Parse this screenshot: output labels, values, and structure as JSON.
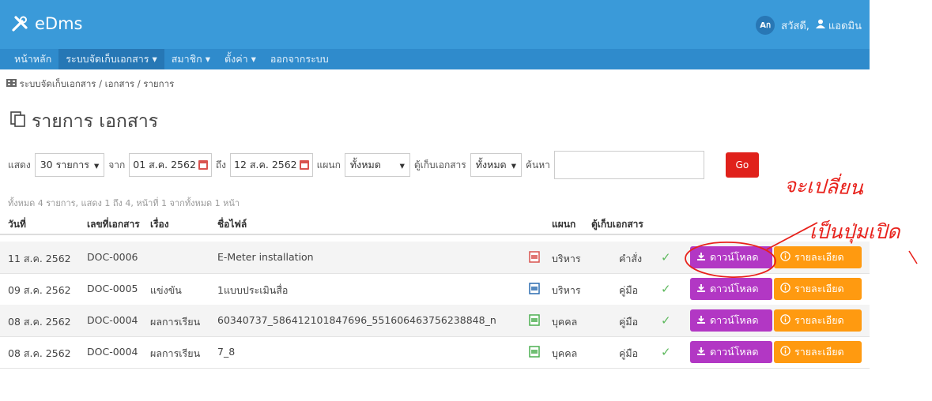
{
  "app": {
    "brand": "eDms",
    "lang_badge": "Aก",
    "greeting": "สวัสดี, ",
    "user_name": "แอดมิน"
  },
  "menu": [
    {
      "label": "หน้าหลัก",
      "dropdown": false
    },
    {
      "label": "ระบบจัดเก็บเอกสาร",
      "dropdown": true
    },
    {
      "label": "สมาชิก",
      "dropdown": true
    },
    {
      "label": "ตั้งค่า",
      "dropdown": true
    },
    {
      "label": "ออกจากระบบ",
      "dropdown": false
    }
  ],
  "breadcrumb": "ระบบจัดเก็บเอกสาร / เอกสาร / รายการ",
  "page_title": "รายการ เอกสาร",
  "filters": {
    "show_label": "แสดง",
    "show_value": "30 รายการ",
    "from_label": "จาก",
    "from_date": "01 ส.ค. 2562",
    "to_label": "ถึง",
    "to_date": "12 ส.ค. 2562",
    "dept_label": "แผนก",
    "dept_value": "ทั้งหมด",
    "cabinet_label": "ตู้เก็บเอกสาร",
    "cabinet_value": "ทั้งหมด",
    "search_label": "ค้นหา",
    "search_value": "",
    "go_label": "Go"
  },
  "summary": "ทั้งหมด 4 รายการ, แสดง 1 ถึง 4, หน้าที่ 1 จากทั้งหมด 1 หน้า",
  "table": {
    "headers": {
      "date": "วันที่",
      "doc_no": "เลขที่เอกสาร",
      "subject": "เรื่อง",
      "filename": "ชื่อไฟล์",
      "dept": "แผนก",
      "cabinet": "ตู้เก็บเอกสาร"
    },
    "rows": [
      {
        "date": "11 ส.ค. 2562",
        "doc_no": "DOC-0006",
        "subject": "",
        "filename": "E-Meter installation",
        "file_icon": "pdf-icon",
        "dept": "บริหาร",
        "cabinet": "คำสั่ง"
      },
      {
        "date": "09 ส.ค. 2562",
        "doc_no": "DOC-0005",
        "subject": "แข่งขัน",
        "filename": "1แบบประเมินสื่อ",
        "file_icon": "word-icon",
        "dept": "บริหาร",
        "cabinet": "คู่มือ"
      },
      {
        "date": "08 ส.ค. 2562",
        "doc_no": "DOC-0004",
        "subject": "ผลการเรียน",
        "filename": "60340737_586412101847696_551606463756238848_n",
        "file_icon": "image-icon",
        "dept": "บุคคล",
        "cabinet": "คู่มือ"
      },
      {
        "date": "08 ส.ค. 2562",
        "doc_no": "DOC-0004",
        "subject": "ผลการเรียน",
        "filename": "7_8",
        "file_icon": "image-icon",
        "dept": "บุคคล",
        "cabinet": "คู่มือ"
      }
    ],
    "download_label": "ดาวน์โหลด",
    "detail_label": "รายละเอียด"
  },
  "annotation": {
    "line1": "จะเปลี่ยน",
    "line2": "เป็นปุ่มเปิด",
    "color": "#e8211b"
  },
  "colors": {
    "header": "#3a9ad9",
    "menu": "#2f8bcc",
    "download": "#b237c4",
    "detail": "#ff9a10",
    "go": "#e0211b"
  }
}
